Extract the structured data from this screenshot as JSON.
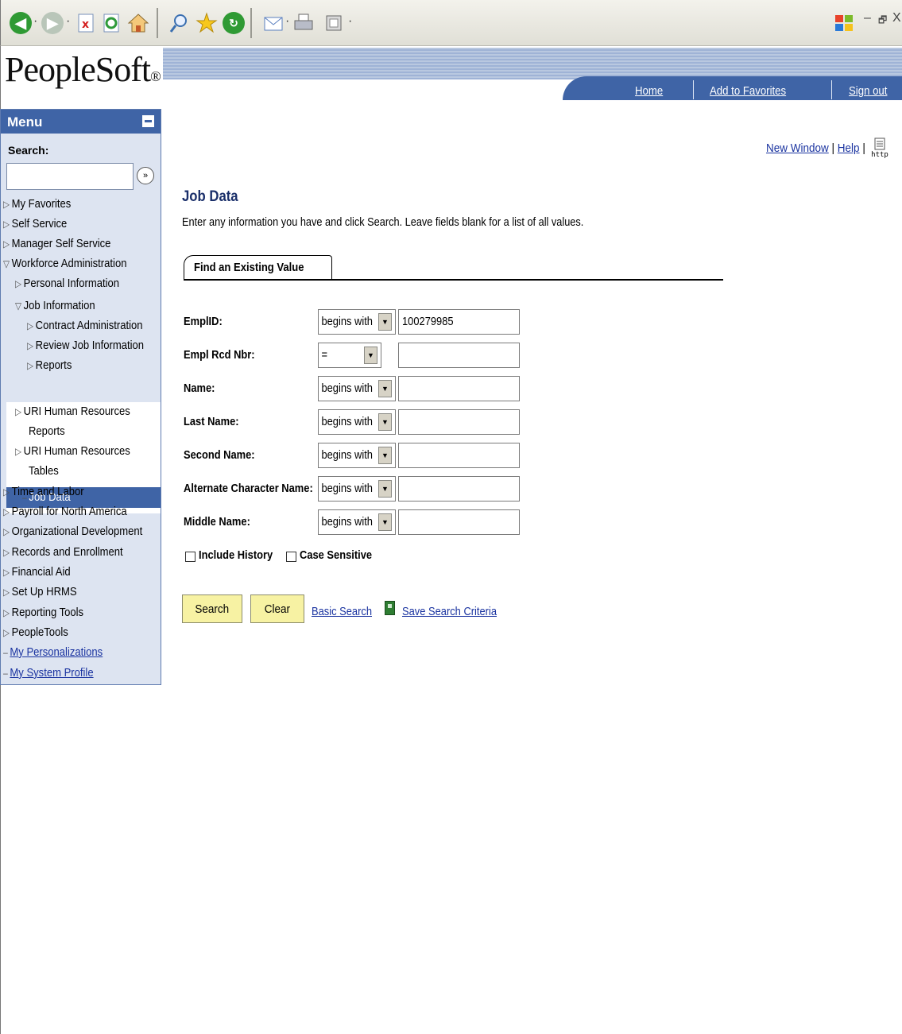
{
  "browser": {
    "toolbar_icons": [
      "back-icon",
      "forward-icon",
      "stop-icon",
      "refresh-icon",
      "home-icon",
      "search-icon",
      "favorites-icon",
      "history-icon",
      "mail-icon",
      "print-icon",
      "edit-icon"
    ],
    "window_controls": {
      "minimize": "–",
      "restore": "🗗",
      "close": "X"
    }
  },
  "header": {
    "logo_text": "PeopleSoft",
    "logo_mark": "®",
    "links": {
      "home": "Home",
      "favorites": "Add to Favorites",
      "signout": "Sign out"
    },
    "colors": {
      "nav_blue": "#3f64a6",
      "banner": "#b9c8e0"
    }
  },
  "menu": {
    "title": "Menu",
    "search_label": "Search:",
    "search_value": "",
    "go_glyph": "»",
    "items": [
      {
        "label": "My Favorites",
        "level": 0,
        "state": "collapsed"
      },
      {
        "label": "Self Service",
        "level": 0,
        "state": "collapsed"
      },
      {
        "label": "Manager Self Service",
        "level": 0,
        "state": "collapsed"
      },
      {
        "label": "Workforce Administration",
        "level": 0,
        "state": "expanded"
      },
      {
        "label": "Personal Information",
        "level": 1,
        "state": "collapsed"
      },
      {
        "label": "Job Information",
        "level": 1,
        "state": "expanded"
      },
      {
        "label": "Contract Administration",
        "level": 2,
        "state": "collapsed"
      },
      {
        "label": "Review Job Information",
        "level": 2,
        "state": "collapsed"
      },
      {
        "label": "Reports",
        "level": 2,
        "state": "collapsed"
      },
      {
        "label": "Job Data",
        "level": 2,
        "state": "selected"
      },
      {
        "label": "URI Human Resources",
        "level": 1,
        "state": "collapsed"
      },
      {
        "label": "Reports",
        "level": 1,
        "state": "continuation"
      },
      {
        "label": "URI Human Resources",
        "level": 1,
        "state": "collapsed"
      },
      {
        "label": "Tables",
        "level": 1,
        "state": "continuation"
      },
      {
        "label": "Time and Labor",
        "level": 0,
        "state": "collapsed"
      },
      {
        "label": "Payroll for North America",
        "level": 0,
        "state": "collapsed"
      },
      {
        "label": "Organizational Development",
        "level": 0,
        "state": "collapsed"
      },
      {
        "label": "Records and Enrollment",
        "level": 0,
        "state": "collapsed"
      },
      {
        "label": "Financial Aid",
        "level": 0,
        "state": "collapsed"
      },
      {
        "label": "Set Up HRMS",
        "level": 0,
        "state": "collapsed"
      },
      {
        "label": "Reporting Tools",
        "level": 0,
        "state": "collapsed"
      },
      {
        "label": "PeopleTools",
        "level": 0,
        "state": "collapsed"
      },
      {
        "label": "My Personalizations",
        "level": 0,
        "state": "link"
      },
      {
        "label": "My System Profile",
        "level": 0,
        "state": "link"
      }
    ]
  },
  "main": {
    "top_links": {
      "new_window": "New Window",
      "help": "Help",
      "sep": "|",
      "http_label": "http"
    },
    "title": "Job Data",
    "instructions": "Enter any information you have and click Search. Leave fields blank for a list of all values.",
    "tab_label": "Find an Existing Value",
    "fields": [
      {
        "label": "EmplID:",
        "operator": "begins with",
        "value": "100279985"
      },
      {
        "label": "Empl Rcd Nbr:",
        "operator": "=",
        "value": ""
      },
      {
        "label": "Name:",
        "operator": "begins with",
        "value": ""
      },
      {
        "label": "Last Name:",
        "operator": "begins with",
        "value": ""
      },
      {
        "label": "Second Name:",
        "operator": "begins with",
        "value": ""
      },
      {
        "label": "Alternate Character Name:",
        "operator": "begins with",
        "value": ""
      },
      {
        "label": "Middle Name:",
        "operator": "begins with",
        "value": ""
      }
    ],
    "checkboxes": {
      "include_history": "Include History",
      "case_sensitive": "Case Sensitive"
    },
    "buttons": {
      "search": "Search",
      "clear": "Clear"
    },
    "links": {
      "basic_search": "Basic Search",
      "save_criteria": "Save Search Criteria"
    },
    "colors": {
      "button_bg": "#f7f2a3",
      "link": "#1a33a0",
      "title": "#1a2f6a"
    }
  }
}
